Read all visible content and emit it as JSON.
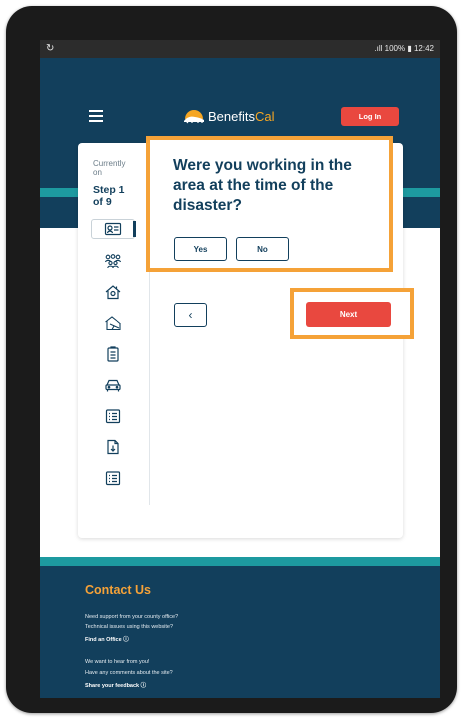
{
  "status_bar": {
    "left_icon": "sync-icon",
    "signal": ".ıll",
    "battery": "100%",
    "time": "12:42"
  },
  "header": {
    "logo": {
      "part1": "Benefits",
      "part2": "Cal"
    },
    "login_label": "Log In"
  },
  "sidebar": {
    "currently_on": "Currently on",
    "step": "Step 1 of 9",
    "icons": [
      "id-card-icon",
      "household-icon",
      "home-icon",
      "property-damage-icon",
      "clipboard-icon",
      "car-icon",
      "list-icon",
      "document-icon",
      "checklist-icon"
    ]
  },
  "question": {
    "text": "Were you working in the area at the time of the disaster?",
    "yes_label": "Yes",
    "no_label": "No"
  },
  "nav": {
    "back_label": "‹",
    "next_label": "Next"
  },
  "footer": {
    "heading": "Contact Us",
    "line1": "Need support from your county office?",
    "line2": "Technical issues using this website?",
    "link1": "Find an Office ⓘ",
    "line3": "We want to hear from you!",
    "line4": "Have any comments about the site?",
    "link2": "Share your feedback ⓘ"
  },
  "colors": {
    "navy": "#123f5c",
    "teal": "#1d9aa0",
    "orange": "#f5a238",
    "red": "#e9483f"
  }
}
